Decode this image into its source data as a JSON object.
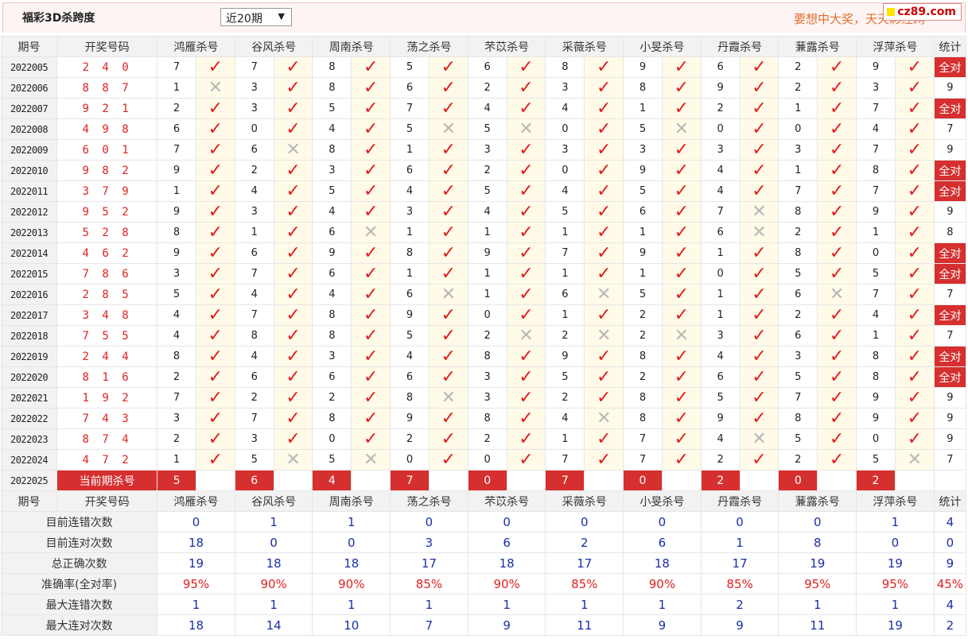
{
  "header": {
    "title": "福彩3D杀跨度",
    "range_select": "近20期",
    "slogan": "要想中大奖，天天彩经网",
    "logo": "cz89.com"
  },
  "columns": {
    "issue": "期号",
    "winning": "开奖号码",
    "experts": [
      "鸿雁杀号",
      "谷风杀号",
      "周南杀号",
      "荡之杀号",
      "芣苡杀号",
      "采薇杀号",
      "小旻杀号",
      "丹霞杀号",
      "蒹露杀号",
      "浮萍杀号"
    ],
    "stats": "统计"
  },
  "rows": [
    {
      "issue": "2022005",
      "win": "2 4 0",
      "kills": [
        7,
        7,
        8,
        5,
        6,
        8,
        9,
        6,
        2,
        9
      ],
      "hit": [
        1,
        1,
        1,
        1,
        1,
        1,
        1,
        1,
        1,
        1
      ],
      "stat": "全对"
    },
    {
      "issue": "2022006",
      "win": "8 8 7",
      "kills": [
        1,
        3,
        8,
        6,
        2,
        3,
        8,
        9,
        2,
        3
      ],
      "hit": [
        0,
        1,
        1,
        1,
        1,
        1,
        1,
        1,
        1,
        1
      ],
      "stat": "9"
    },
    {
      "issue": "2022007",
      "win": "9 2 1",
      "kills": [
        2,
        3,
        5,
        7,
        4,
        4,
        1,
        2,
        1,
        7
      ],
      "hit": [
        1,
        1,
        1,
        1,
        1,
        1,
        1,
        1,
        1,
        1
      ],
      "stat": "全对"
    },
    {
      "issue": "2022008",
      "win": "4 9 8",
      "kills": [
        6,
        0,
        4,
        5,
        5,
        0,
        5,
        0,
        0,
        4
      ],
      "hit": [
        1,
        1,
        1,
        0,
        0,
        1,
        0,
        1,
        1,
        1
      ],
      "stat": "7"
    },
    {
      "issue": "2022009",
      "win": "6 0 1",
      "kills": [
        7,
        6,
        8,
        1,
        3,
        3,
        3,
        3,
        3,
        7
      ],
      "hit": [
        1,
        0,
        1,
        1,
        1,
        1,
        1,
        1,
        1,
        1
      ],
      "stat": "9"
    },
    {
      "issue": "2022010",
      "win": "9 8 2",
      "kills": [
        9,
        2,
        3,
        6,
        2,
        0,
        9,
        4,
        1,
        8
      ],
      "hit": [
        1,
        1,
        1,
        1,
        1,
        1,
        1,
        1,
        1,
        1
      ],
      "stat": "全对"
    },
    {
      "issue": "2022011",
      "win": "3 7 9",
      "kills": [
        1,
        4,
        5,
        4,
        5,
        4,
        5,
        4,
        7,
        7
      ],
      "hit": [
        1,
        1,
        1,
        1,
        1,
        1,
        1,
        1,
        1,
        1
      ],
      "stat": "全对"
    },
    {
      "issue": "2022012",
      "win": "9 5 2",
      "kills": [
        9,
        3,
        4,
        3,
        4,
        5,
        6,
        7,
        8,
        9
      ],
      "hit": [
        1,
        1,
        1,
        1,
        1,
        1,
        1,
        0,
        1,
        1
      ],
      "stat": "9"
    },
    {
      "issue": "2022013",
      "win": "5 2 8",
      "kills": [
        8,
        1,
        6,
        1,
        1,
        1,
        1,
        6,
        2,
        1
      ],
      "hit": [
        1,
        1,
        0,
        1,
        1,
        1,
        1,
        0,
        1,
        1
      ],
      "stat": "8"
    },
    {
      "issue": "2022014",
      "win": "4 6 2",
      "kills": [
        9,
        6,
        9,
        8,
        9,
        7,
        9,
        1,
        8,
        0
      ],
      "hit": [
        1,
        1,
        1,
        1,
        1,
        1,
        1,
        1,
        1,
        1
      ],
      "stat": "全对"
    },
    {
      "issue": "2022015",
      "win": "7 8 6",
      "kills": [
        3,
        7,
        6,
        1,
        1,
        1,
        1,
        0,
        5,
        5
      ],
      "hit": [
        1,
        1,
        1,
        1,
        1,
        1,
        1,
        1,
        1,
        1
      ],
      "stat": "全对"
    },
    {
      "issue": "2022016",
      "win": "2 8 5",
      "kills": [
        5,
        4,
        4,
        6,
        1,
        6,
        5,
        1,
        6,
        7
      ],
      "hit": [
        1,
        1,
        1,
        0,
        1,
        0,
        1,
        1,
        0,
        1
      ],
      "stat": "7"
    },
    {
      "issue": "2022017",
      "win": "3 4 8",
      "kills": [
        4,
        7,
        8,
        9,
        0,
        1,
        2,
        1,
        2,
        4
      ],
      "hit": [
        1,
        1,
        1,
        1,
        1,
        1,
        1,
        1,
        1,
        1
      ],
      "stat": "全对"
    },
    {
      "issue": "2022018",
      "win": "7 5 5",
      "kills": [
        4,
        8,
        8,
        5,
        2,
        2,
        2,
        3,
        6,
        1
      ],
      "hit": [
        1,
        1,
        1,
        1,
        0,
        0,
        0,
        1,
        1,
        1
      ],
      "stat": "7"
    },
    {
      "issue": "2022019",
      "win": "2 4 4",
      "kills": [
        8,
        4,
        3,
        4,
        8,
        9,
        8,
        4,
        3,
        8
      ],
      "hit": [
        1,
        1,
        1,
        1,
        1,
        1,
        1,
        1,
        1,
        1
      ],
      "stat": "全对"
    },
    {
      "issue": "2022020",
      "win": "8 1 6",
      "kills": [
        2,
        6,
        6,
        6,
        3,
        5,
        2,
        6,
        5,
        8
      ],
      "hit": [
        1,
        1,
        1,
        1,
        1,
        1,
        1,
        1,
        1,
        1
      ],
      "stat": "全对"
    },
    {
      "issue": "2022021",
      "win": "1 9 2",
      "kills": [
        7,
        2,
        2,
        8,
        3,
        2,
        8,
        5,
        7,
        9
      ],
      "hit": [
        1,
        1,
        1,
        0,
        1,
        1,
        1,
        1,
        1,
        1
      ],
      "stat": "9"
    },
    {
      "issue": "2022022",
      "win": "7 4 3",
      "kills": [
        3,
        7,
        8,
        9,
        8,
        4,
        8,
        9,
        8,
        9
      ],
      "hit": [
        1,
        1,
        1,
        1,
        1,
        0,
        1,
        1,
        1,
        1
      ],
      "stat": "9"
    },
    {
      "issue": "2022023",
      "win": "8 7 4",
      "kills": [
        2,
        3,
        0,
        2,
        2,
        1,
        7,
        4,
        5,
        0
      ],
      "hit": [
        1,
        1,
        1,
        1,
        1,
        1,
        1,
        0,
        1,
        1
      ],
      "stat": "9"
    },
    {
      "issue": "2022024",
      "win": "4 7 2",
      "kills": [
        1,
        5,
        5,
        0,
        0,
        7,
        7,
        2,
        2,
        5
      ],
      "hit": [
        1,
        0,
        0,
        1,
        1,
        1,
        1,
        1,
        1,
        0
      ],
      "stat": "7"
    }
  ],
  "current": {
    "issue": "2022025",
    "label": "当前期杀号",
    "kills": [
      5,
      6,
      4,
      7,
      0,
      7,
      0,
      2,
      0,
      2
    ]
  },
  "summary": [
    {
      "label": "目前连错次数",
      "values": [
        "0",
        "1",
        "1",
        "0",
        "0",
        "0",
        "0",
        "0",
        "0",
        "1"
      ],
      "stat": "4",
      "red": false
    },
    {
      "label": "目前连对次数",
      "values": [
        "18",
        "0",
        "0",
        "3",
        "6",
        "2",
        "6",
        "1",
        "8",
        "0"
      ],
      "stat": "0",
      "red": false
    },
    {
      "label": "总正确次数",
      "values": [
        "19",
        "18",
        "18",
        "17",
        "18",
        "17",
        "18",
        "17",
        "19",
        "19"
      ],
      "stat": "9",
      "red": false
    },
    {
      "label": "准确率(全对率)",
      "values": [
        "95%",
        "90%",
        "90%",
        "85%",
        "90%",
        "85%",
        "90%",
        "85%",
        "95%",
        "95%"
      ],
      "stat": "45%",
      "red": true
    },
    {
      "label": "最大连错次数",
      "values": [
        "1",
        "1",
        "1",
        "1",
        "1",
        "1",
        "1",
        "2",
        "1",
        "1"
      ],
      "stat": "4",
      "red": false
    },
    {
      "label": "最大连对次数",
      "values": [
        "18",
        "14",
        "10",
        "7",
        "9",
        "11",
        "9",
        "9",
        "11",
        "19"
      ],
      "stat": "2",
      "red": false
    }
  ],
  "marks": {
    "hit": "✓",
    "miss": "✕"
  },
  "colors": {
    "accent_red": "#d62f2f",
    "check_red": "#e21d1d",
    "value_blue": "#1a2fa8",
    "slogan_orange": "#e07030"
  }
}
